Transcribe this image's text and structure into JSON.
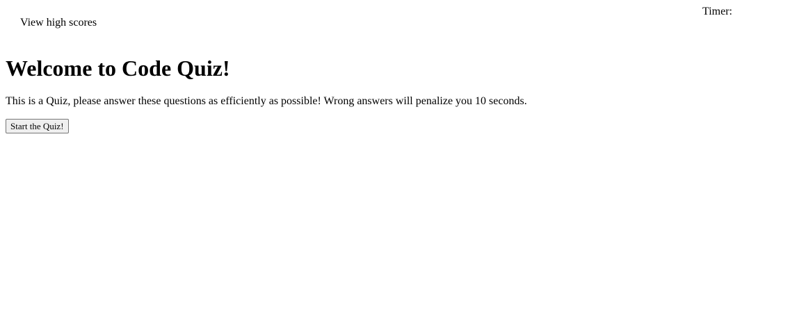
{
  "header": {
    "view_high_scores": "View high scores",
    "timer_label": "Timer:"
  },
  "main": {
    "title": "Welcome to Code Quiz!",
    "description": "This is a Quiz, please answer these questions as efficiently as possible! Wrong answers will penalize you 10 seconds.",
    "start_button_label": "Start the Quiz!"
  }
}
